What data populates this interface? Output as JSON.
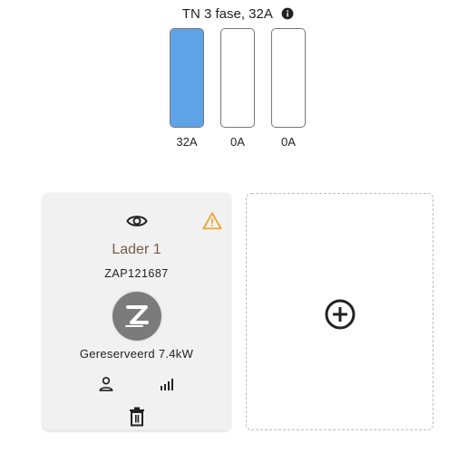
{
  "phase": {
    "title": "TN 3 fase, 32A",
    "bars": [
      {
        "label": "32A",
        "level": 1.0
      },
      {
        "label": "0A",
        "level": 0.0
      },
      {
        "label": "0A",
        "level": 0.0
      }
    ],
    "fill_color": "#5ea3e8"
  },
  "chargers": [
    {
      "name": "Lader 1",
      "serial": "ZAP121687",
      "status": "Gereserveerd 7.4kW",
      "warning_color": "#f0a534"
    }
  ],
  "icons": {
    "info": "info-icon",
    "eye": "eye-icon",
    "warning": "warning-icon",
    "logo": "zaptec-logo",
    "user": "person-icon",
    "signal": "signal-icon",
    "trash": "trash-icon",
    "add": "add-circle-icon"
  }
}
